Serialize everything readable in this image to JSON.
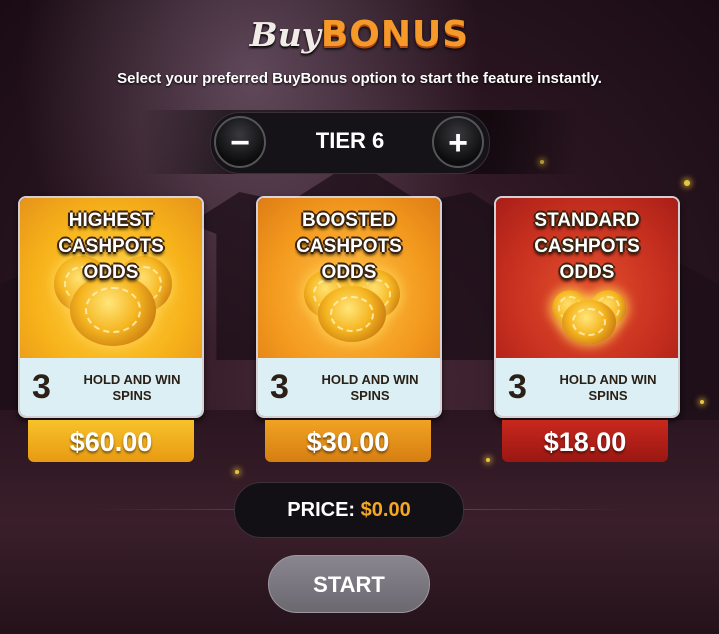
{
  "header": {
    "title_buy": "Buy",
    "title_bonus": "BONUS",
    "subtitle": "Select your preferred BuyBonus option to start the feature instantly."
  },
  "tier": {
    "label": "TIER 6",
    "minus_label": "−",
    "plus_label": "+"
  },
  "cards": [
    {
      "title_lines": [
        "HIGHEST",
        "CASHPOTS",
        "ODDS"
      ],
      "spins": "3",
      "spins_text": "HOLD AND WIN SPINS",
      "price": "$60.00",
      "color": "#f7b21a"
    },
    {
      "title_lines": [
        "BOOSTED",
        "CASHPOTS",
        "ODDS"
      ],
      "spins": "3",
      "spins_text": "HOLD AND WIN SPINS",
      "price": "$30.00",
      "color": "#f39a1e"
    },
    {
      "title_lines": [
        "STANDARD",
        "CASHPOTS",
        "ODDS"
      ],
      "spins": "3",
      "spins_text": "HOLD AND WIN SPINS",
      "price": "$18.00",
      "color": "#c7301f"
    }
  ],
  "price": {
    "label": "PRICE:",
    "value": "$0.00",
    "value_color": "#f5a623"
  },
  "start_label": "START"
}
